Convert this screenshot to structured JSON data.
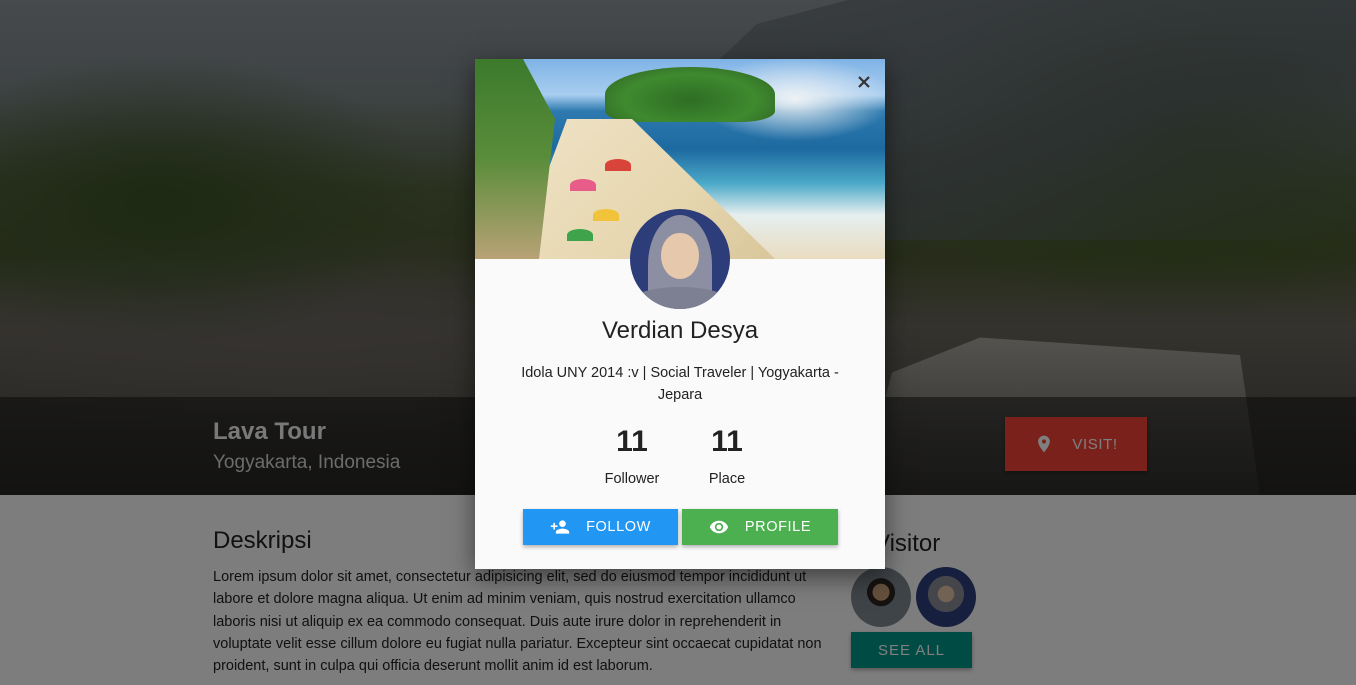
{
  "hero": {
    "title": "Lava Tour",
    "location": "Yogyakarta, Indonesia",
    "visit_label": "VISIT!",
    "visit_color": "#f44336"
  },
  "content": {
    "description_title": "Deskripsi",
    "description_text": "Lorem ipsum dolor sit amet, consectetur adipisicing elit, sed do eiusmod tempor incididunt ut labore et dolore magna aliqua. Ut enim ad minim veniam, quis nostrud exercitation ullamco laboris nisi ut aliquip ex ea commodo consequat. Duis aute irure dolor in reprehenderit in voluptate velit esse cillum dolore eu fugiat nulla pariatur. Excepteur sint occaecat cupidatat non proident, sunt in culpa qui officia deserunt mollit anim id est laborum.",
    "visitor_title": "Visitor",
    "see_all_label": "SEE ALL"
  },
  "modal": {
    "name": "Verdian Desya",
    "bio": "Idola UNY 2014 :v | Social Traveler | Yogyakarta - Jepara",
    "stats": [
      {
        "value": "11",
        "label": "Follower"
      },
      {
        "value": "11",
        "label": "Place"
      }
    ],
    "follow_label": "FOLLOW",
    "profile_label": "PROFILE",
    "follow_color": "#2196f3",
    "profile_color": "#4caf50"
  }
}
